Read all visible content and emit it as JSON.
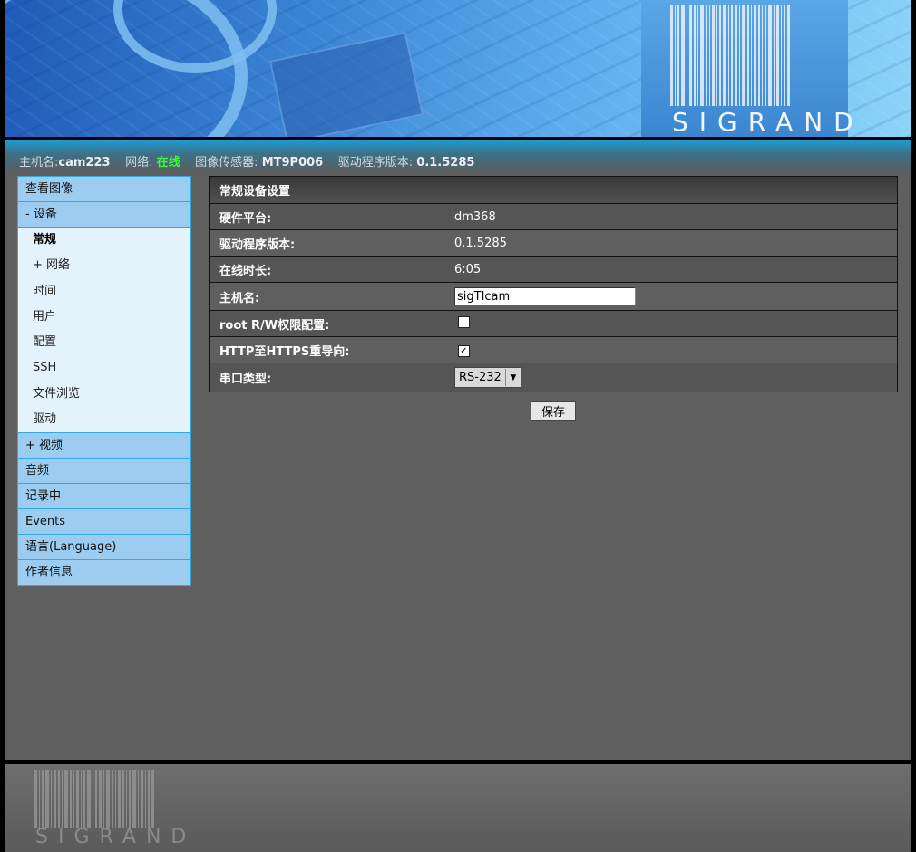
{
  "header": {
    "logo_text": "SIGRAND"
  },
  "status": {
    "host_label": "主机名:",
    "host_value": "cam223",
    "network_label": "网络:",
    "network_value": "在线",
    "sensor_label": "图像传感器:",
    "sensor_value": "MT9P006",
    "driver_label": "驱动程序版本:",
    "driver_value": "0.1.5285",
    "online_color": "#33ff33"
  },
  "sidebar": {
    "view_image": "查看图像",
    "device": "- 设备",
    "device_items": [
      "常规",
      "+ 网络",
      "时间",
      "用户",
      "配置",
      "SSH",
      "文件浏览",
      "驱动"
    ],
    "video": "+ 视频",
    "audio": "音频",
    "recording": "记录中",
    "events": "Events",
    "language": "语言(Language)",
    "about": "作者信息"
  },
  "panel": {
    "title": "常规设备设置",
    "hw_label": "硬件平台:",
    "hw_value": "dm368",
    "driver_label": "驱动程序版本:",
    "driver_value": "0.1.5285",
    "uptime_label": "在线时长:",
    "uptime_value": "6:05",
    "hostname_label": "主机名:",
    "hostname_value": "sigTIcam",
    "root_label": "root R/W权限配置:",
    "root_checked": false,
    "https_label": "HTTP至HTTPS重导向:",
    "https_checked": true,
    "serial_label": "串口类型:",
    "serial_value": "RS-232",
    "save_label": "保存"
  },
  "footer": {
    "logo_text": "SIGRAND"
  }
}
